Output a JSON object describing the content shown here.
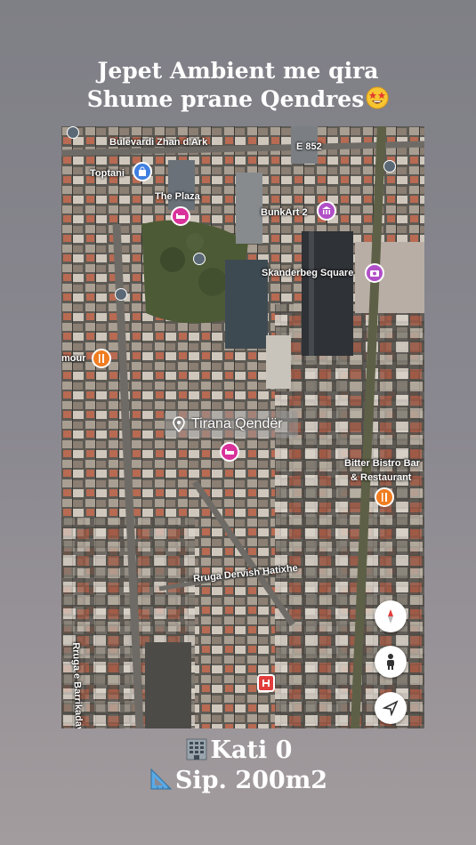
{
  "headline": {
    "line1": "Jepet Ambient me qira",
    "line2": "Shume prane Qendres",
    "emoji": "star-struck-face"
  },
  "map": {
    "center_label": "Tirana Qendër",
    "labels": {
      "bulevardi": "Bulevardi Zhan d'Ark",
      "e852": "E 852",
      "toptani": "Toptani",
      "the_plaza": "The Plaza",
      "bunkart": "BunkArt 2",
      "skanderbeg": "Skanderbeg Square",
      "amour": "mour",
      "bitter1": "Bitter Bistro Bar",
      "bitter2": "& Restaurant",
      "rruga_dervish": "Rruga Dervish Hatixhe",
      "rruga_barrikadave": "Rruga e Barrikadave"
    },
    "icons": {
      "shopping": "shopping-bag-icon",
      "hotel": "hotel-bed-icon",
      "museum": "museum-icon",
      "camera": "camera-icon",
      "restaurant": "restaurant-icon",
      "hospital": "hospital-icon",
      "transit": "bus-stop-icon"
    },
    "colors": {
      "purple_pin": "#b04fc7",
      "pink_pin": "#d9329b",
      "orange_pin": "#f07d22",
      "blue_pin": "#3f7fe0",
      "red_pin": "#e23c3c"
    }
  },
  "controls": [
    "compass-icon",
    "pegman-icon",
    "location-arrow-icon"
  ],
  "footer": {
    "floor": "Kati 0",
    "floor_icon": "office-building-icon",
    "area": "Sip. 200m2",
    "area_icon": "triangular-ruler-icon"
  }
}
